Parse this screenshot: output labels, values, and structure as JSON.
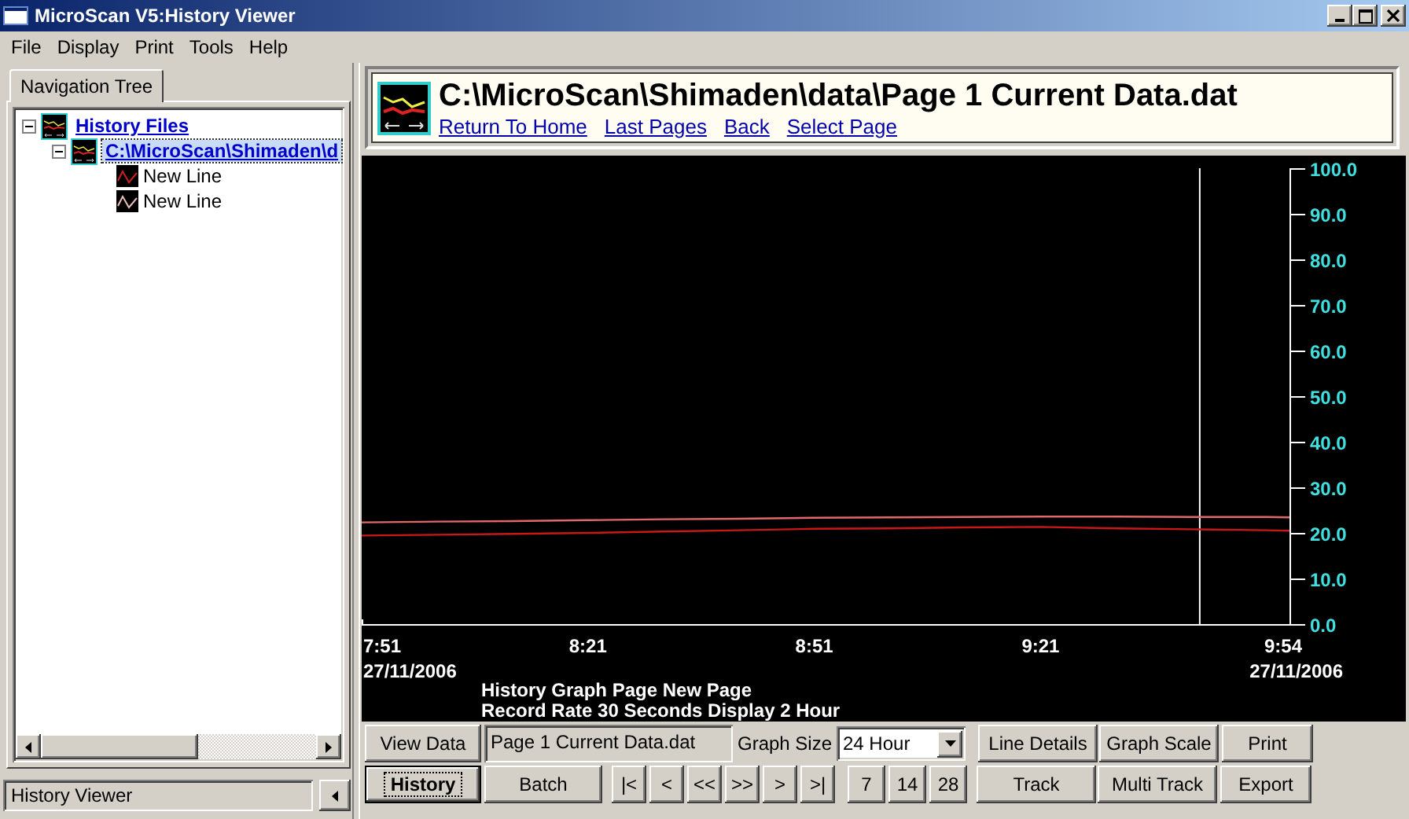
{
  "window": {
    "title": "MicroScan V5:History Viewer"
  },
  "menu": [
    "File",
    "Display",
    "Print",
    "Tools",
    "Help"
  ],
  "navigation": {
    "tab": "Navigation Tree",
    "tree": [
      {
        "label": "History Files",
        "expanded": true,
        "selected": false,
        "children": [
          {
            "label": "C:\\MicroScan\\Shimaden\\d",
            "expanded": true,
            "selected": true,
            "children": [
              {
                "label": "New Line",
                "selected": false
              },
              {
                "label": "New Line",
                "selected": false
              }
            ]
          }
        ]
      }
    ],
    "status": "History Viewer"
  },
  "header": {
    "title": "C:\\MicroScan\\Shimaden\\data\\Page 1 Current Data.dat",
    "links": [
      "Return To Home",
      "Last Pages",
      "Back",
      "Select Page"
    ]
  },
  "graph": {
    "start_date": "27/11/2006",
    "end_date": "27/11/2006",
    "caption": [
      "History Graph Page New Page",
      "Record Rate 30 Seconds Display 2 Hour"
    ],
    "chart_data": {
      "type": "line",
      "x": [
        7.85,
        8.0167,
        8.1833,
        8.35,
        8.5167,
        8.6833,
        8.85,
        9.0167,
        9.1833,
        9.35,
        9.5167,
        9.6833,
        9.85,
        9.9
      ],
      "series": [
        {
          "color": "#e06868",
          "values": [
            22.3,
            22.5,
            22.6,
            22.8,
            23.0,
            23.1,
            23.3,
            23.4,
            23.5,
            23.6,
            23.6,
            23.5,
            23.5,
            23.4
          ]
        },
        {
          "color": "#c81818",
          "values": [
            19.4,
            19.6,
            19.8,
            20.0,
            20.3,
            20.6,
            20.9,
            21.0,
            21.2,
            21.3,
            21.0,
            20.8,
            20.6,
            20.5
          ]
        }
      ],
      "xlim": [
        7.85,
        9.9
      ],
      "ylim": [
        0,
        100
      ],
      "xticks": [
        {
          "value": 7.85,
          "label": "7:51"
        },
        {
          "value": 8.35,
          "label": "8:21"
        },
        {
          "value": 8.85,
          "label": "8:51"
        },
        {
          "value": 9.35,
          "label": "9:21"
        },
        {
          "value": 9.9,
          "label": "9:54"
        }
      ],
      "yticks": [
        {
          "value": 0,
          "label": "0.0"
        },
        {
          "value": 10,
          "label": "10.0"
        },
        {
          "value": 20,
          "label": "20.0"
        },
        {
          "value": 30,
          "label": "30.0"
        },
        {
          "value": 40,
          "label": "40.0"
        },
        {
          "value": 50,
          "label": "50.0"
        },
        {
          "value": 60,
          "label": "60.0"
        },
        {
          "value": 70,
          "label": "70.0"
        },
        {
          "value": 80,
          "label": "80.0"
        },
        {
          "value": 90,
          "label": "90.0"
        },
        {
          "value": 100,
          "label": "100.0"
        }
      ],
      "ref_lines": [
        {
          "axis": "x",
          "value": 9.7
        }
      ]
    }
  },
  "toolbar_top": [
    {
      "kind": "button",
      "label": "View Data",
      "focused": false
    },
    {
      "kind": "field",
      "value": "Page 1 Current Data.dat"
    },
    {
      "kind": "label",
      "text": "Graph Size"
    },
    {
      "kind": "dropdown",
      "value": "24 Hour"
    },
    {
      "kind": "button",
      "label": "Line Details",
      "focused": false
    },
    {
      "kind": "button",
      "label": "Graph Scale",
      "focused": false
    },
    {
      "kind": "button",
      "label": "Print",
      "focused": false
    }
  ],
  "toolbar_bottom": [
    {
      "kind": "button",
      "label": "History",
      "focused": true
    },
    {
      "kind": "button",
      "label": "Batch",
      "focused": false
    },
    {
      "kind": "button",
      "label": "|<",
      "focused": false
    },
    {
      "kind": "button",
      "label": "<",
      "focused": false
    },
    {
      "kind": "button",
      "label": "<<",
      "focused": false
    },
    {
      "kind": "button",
      "label": ">>",
      "focused": false
    },
    {
      "kind": "button",
      "label": ">",
      "focused": false
    },
    {
      "kind": "button",
      "label": ">|",
      "focused": false
    },
    {
      "kind": "button",
      "label": "7",
      "focused": false
    },
    {
      "kind": "button",
      "label": "14",
      "focused": false
    },
    {
      "kind": "button",
      "label": "28",
      "focused": false
    },
    {
      "kind": "button",
      "label": "Track",
      "focused": false
    },
    {
      "kind": "button",
      "label": "Multi Track",
      "focused": false
    },
    {
      "kind": "button",
      "label": "Export",
      "focused": false
    }
  ]
}
